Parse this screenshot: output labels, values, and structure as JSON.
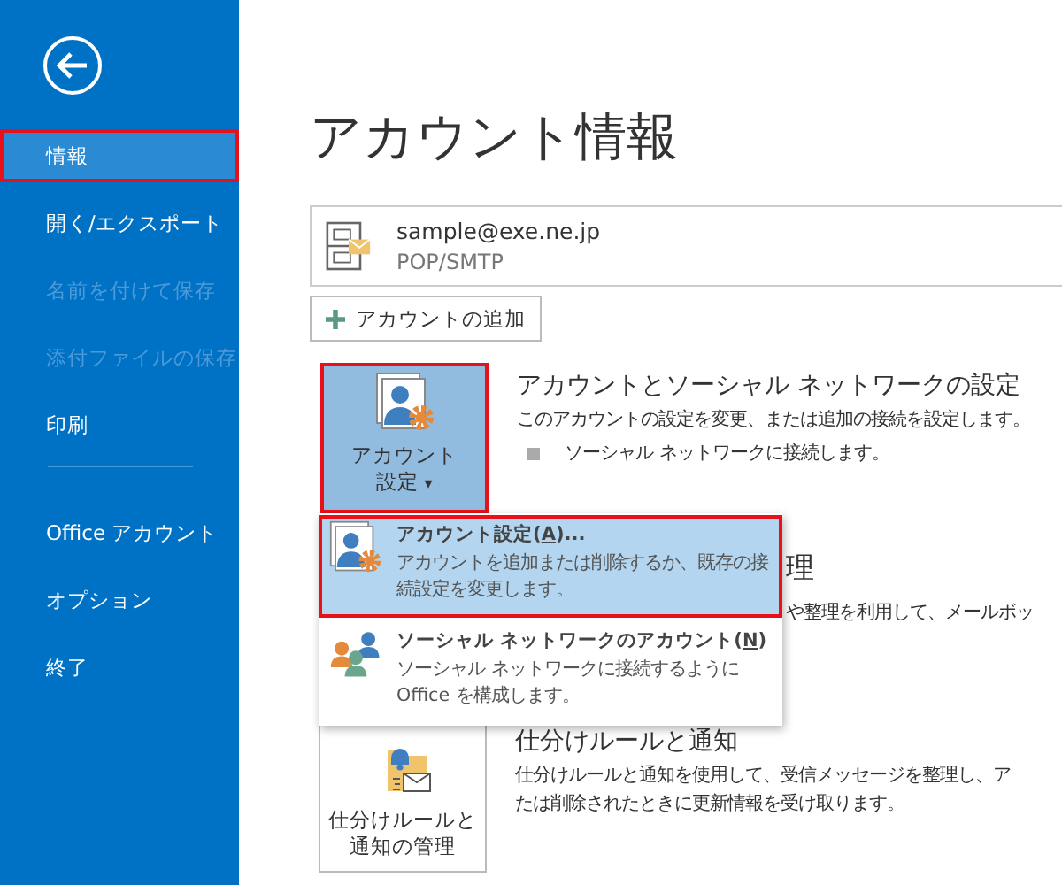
{
  "sidebar": {
    "groups": [
      {
        "items": [
          {
            "label": "情報",
            "selected": true,
            "disabled": false,
            "highlighted": true
          },
          {
            "label": "開く/エクスポート",
            "selected": false,
            "disabled": false,
            "highlighted": false
          },
          {
            "label": "名前を付けて保存",
            "selected": false,
            "disabled": true,
            "highlighted": false
          },
          {
            "label": "添付ファイルの保存",
            "selected": false,
            "disabled": true,
            "highlighted": false
          },
          {
            "label": "印刷",
            "selected": false,
            "disabled": false,
            "highlighted": false
          }
        ]
      },
      {
        "items": [
          {
            "label": "Office アカウント",
            "selected": false,
            "disabled": false,
            "highlighted": false
          },
          {
            "label": "オプション",
            "selected": false,
            "disabled": false,
            "highlighted": false
          },
          {
            "label": "終了",
            "selected": false,
            "disabled": false,
            "highlighted": false
          }
        ]
      }
    ]
  },
  "page_title": "アカウント情報",
  "account": {
    "email": "sample@exe.ne.jp",
    "type": "POP/SMTP"
  },
  "add_account_button": "アカウントの追加",
  "sections": [
    {
      "kind": "settings",
      "button": {
        "lines": [
          "アカウント",
          "設定"
        ],
        "pressed": true,
        "highlighted": true,
        "caret": "▾"
      },
      "heading": "アカウントとソーシャル ネットワークの設定",
      "description": "このアカウントの設定を変更、または追加の接続を設定します。",
      "bullets": [
        "ソーシャル ネットワークに接続します。"
      ]
    },
    {
      "kind": "hidden",
      "heading": "理",
      "description": "や整理を利用して、メールボッ"
    },
    {
      "kind": "rules",
      "button": {
        "lines": [
          "仕分けルールと",
          "通知の管理"
        ],
        "pressed": false,
        "highlighted": false
      },
      "heading": "仕分けルールと通知",
      "description": "仕分けルールと通知を使用して、受信メッセージを整理し、ア",
      "description_2": "たは削除されたときに更新情報を受け取ります。"
    }
  ],
  "dropdown_menu": [
    {
      "kind": "settings",
      "before": "アカウント設定(",
      "key": "A",
      "after": ")...",
      "description": "アカウントを追加または削除するか、既存の接続設定を変更します。",
      "selected": true,
      "highlighted": true
    },
    {
      "kind": "social",
      "before": "ソーシャル ネットワークのアカウント(",
      "key": "N",
      "after": ")",
      "description": "ソーシャル ネットワークに接続するように Office を構成します。",
      "selected": false,
      "highlighted": false
    }
  ]
}
